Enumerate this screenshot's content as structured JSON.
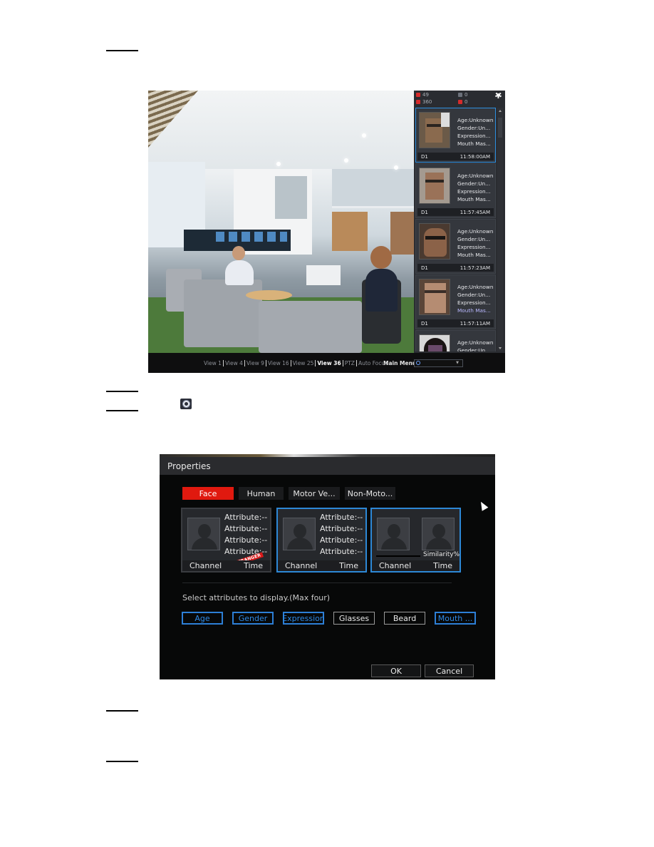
{
  "page": {
    "step_markers": [
      "",
      "",
      "",
      "",
      "",
      ""
    ]
  },
  "live_view": {
    "stats": {
      "face_count": "49",
      "human_count": "0",
      "vehicle_count": "360",
      "non_motor_count": "0"
    },
    "sidebar_cards": [
      {
        "channel": "D1",
        "time": "11:58:00AM",
        "attrs": [
          "Age:Unknown",
          "Gender:Un...",
          "Expression...",
          "Mouth Mas..."
        ],
        "selected": true
      },
      {
        "channel": "D1",
        "time": "11:57:45AM",
        "attrs": [
          "Age:Unknown",
          "Gender:Un...",
          "Expression...",
          "Mouth Mas..."
        ],
        "selected": false
      },
      {
        "channel": "D1",
        "time": "11:57:23AM",
        "attrs": [
          "Age:Unknown",
          "Gender:Un...",
          "Expression...",
          "Mouth Mas..."
        ],
        "selected": false
      },
      {
        "channel": "D1",
        "time": "11:57:11AM",
        "attrs": [
          "Age:Unknown",
          "Gender:Un...",
          "Expression...",
          "Mouth Mas..."
        ],
        "selected": false
      },
      {
        "channel": "",
        "time": "",
        "attrs": [
          "Age:Unknown",
          "Gender:Un..."
        ],
        "selected": false
      }
    ],
    "taskbar": {
      "views": [
        "View 1",
        "View 4",
        "View 9",
        "View 16",
        "View 25",
        "View 36",
        "PTZ",
        "Auto Focus"
      ],
      "active_view": "View 36",
      "main_menu_label": "Main Menu",
      "search_value": ""
    }
  },
  "properties_dialog": {
    "title": "Properties",
    "tabs": [
      {
        "label": "Face",
        "active": true
      },
      {
        "label": "Human",
        "active": false
      },
      {
        "label": "Motor Ve...",
        "active": false
      },
      {
        "label": "Non-Moto...",
        "active": false
      }
    ],
    "display_styles": [
      {
        "attributes": [
          "Attribute:--",
          "Attribute:--",
          "Attribute:--",
          "Attribute:--"
        ],
        "channel_label": "Channel",
        "time_label": "Time",
        "badge": "STRANGER",
        "selected": false
      },
      {
        "attributes": [
          "Attribute:--",
          "Attribute:--",
          "Attribute:--",
          "Attribute:--"
        ],
        "channel_label": "Channel",
        "time_label": "Time",
        "selected": true
      },
      {
        "similarity_label": "Similarity%",
        "channel_label": "Channel",
        "time_label": "Time",
        "selected": true
      }
    ],
    "prompt": "Select attributes to display.(Max four)",
    "attribute_options": [
      {
        "label": "Age",
        "selected": true
      },
      {
        "label": "Gender",
        "selected": true
      },
      {
        "label": "Expression",
        "selected": true
      },
      {
        "label": "Glasses",
        "selected": false
      },
      {
        "label": "Beard",
        "selected": false
      },
      {
        "label": "Mouth ...",
        "selected": true
      }
    ],
    "ok_label": "OK",
    "cancel_label": "Cancel"
  },
  "colors": {
    "accent_red": "#e0190f",
    "accent_blue": "#2d88d6",
    "dialog_bg": "#070808"
  }
}
